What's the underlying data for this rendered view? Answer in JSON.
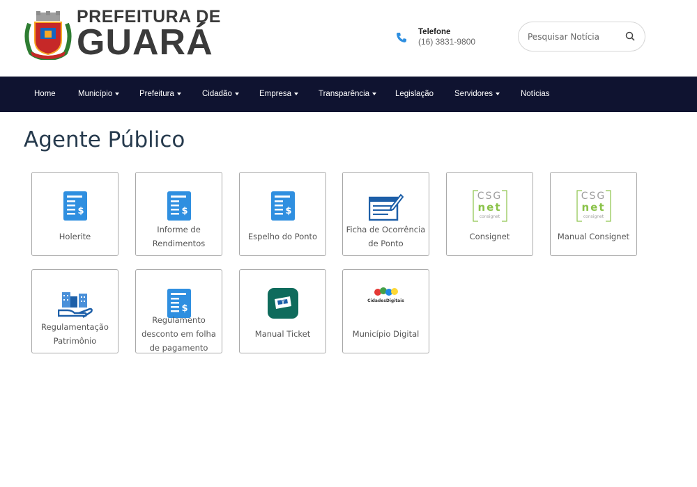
{
  "header": {
    "logo_line1": "PREFEITURA DE",
    "logo_line2": "GUARÁ",
    "phone_label": "Telefone",
    "phone_number": "(16) 3831-9800",
    "search_placeholder": "Pesquisar Notícia"
  },
  "nav": {
    "items": [
      {
        "label": "Home",
        "dropdown": false
      },
      {
        "label": "Município",
        "dropdown": true
      },
      {
        "label": "Prefeitura",
        "dropdown": true
      },
      {
        "label": "Cidadão",
        "dropdown": true
      },
      {
        "label": "Empresa",
        "dropdown": true
      },
      {
        "label": "Transparência",
        "dropdown": true
      },
      {
        "label": "Legislação",
        "dropdown": false
      },
      {
        "label": "Servidores",
        "dropdown": true
      },
      {
        "label": "Notícias",
        "dropdown": false
      }
    ]
  },
  "page": {
    "title": "Agente Público"
  },
  "cards": [
    {
      "label": "Holerite",
      "icon": "document-dollar-icon"
    },
    {
      "label": "Informe de Rendimentos",
      "icon": "document-dollar-icon"
    },
    {
      "label": "Espelho do Ponto",
      "icon": "document-dollar-icon"
    },
    {
      "label": "Ficha de Ocorrência de Ponto",
      "icon": "form-pen-icon"
    },
    {
      "label": "Consignet",
      "icon": "csg-net-logo",
      "logo_top": "CSG",
      "logo_bottom": "net",
      "logo_sub": "consignet"
    },
    {
      "label": "Manual Consignet",
      "icon": "csg-net-logo",
      "logo_top": "CSG",
      "logo_bottom": "net",
      "logo_sub": "consignet"
    },
    {
      "label": "Regulamentação Patrimônio",
      "icon": "buildings-hand-icon"
    },
    {
      "label": "Regulamento desconto em folha de pagamento",
      "icon": "document-dollar-icon"
    },
    {
      "label": "Manual Ticket",
      "icon": "ticket-app-icon"
    },
    {
      "label": "Município Digital",
      "icon": "cidades-digitais-logo",
      "logo_text": "CidadesDigitais"
    }
  ],
  "colors": {
    "nav_bg": "#0f1330",
    "icon_blue": "#2f8fe0",
    "title": "#263a4d",
    "csg_green": "#8bc34a"
  }
}
